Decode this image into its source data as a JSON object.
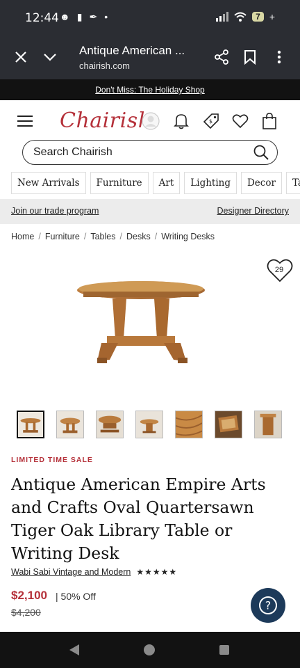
{
  "status_bar": {
    "time": "12:44",
    "battery": "7"
  },
  "browser": {
    "page_title": "Antique American ...",
    "url": "chairish.com"
  },
  "promo": {
    "text": "Don't Miss: The Holiday Shop"
  },
  "header": {
    "logo": "Chairish"
  },
  "search": {
    "placeholder": "Search Chairish"
  },
  "nav": {
    "items": [
      "New Arrivals",
      "Furniture",
      "Art",
      "Lighting",
      "Decor",
      "Ta"
    ]
  },
  "trade": {
    "join_label": "Join our trade program",
    "designer_label": "Designer Directory"
  },
  "breadcrumbs": [
    "Home",
    "Furniture",
    "Tables",
    "Desks",
    "Writing Desks"
  ],
  "product": {
    "favorite_count": "29",
    "sale_badge": "LIMITED TIME SALE",
    "title": "Antique American Empire Arts and Crafts Oval Quartersawn Tiger Oak Library Table or Writing Desk",
    "seller": "Wabi Sabi Vintage and Modern",
    "rating_stars": "★★★★★",
    "price": "$2,100",
    "discount": "| 50% Off",
    "original_price": "$4,200",
    "thumbnail_count": 7,
    "selected_thumbnail": 0
  },
  "help": {
    "icon": "?"
  },
  "colors": {
    "brand": "#b5313a",
    "dark_bar": "#2b2d33",
    "help_button": "#1d3a5a"
  }
}
